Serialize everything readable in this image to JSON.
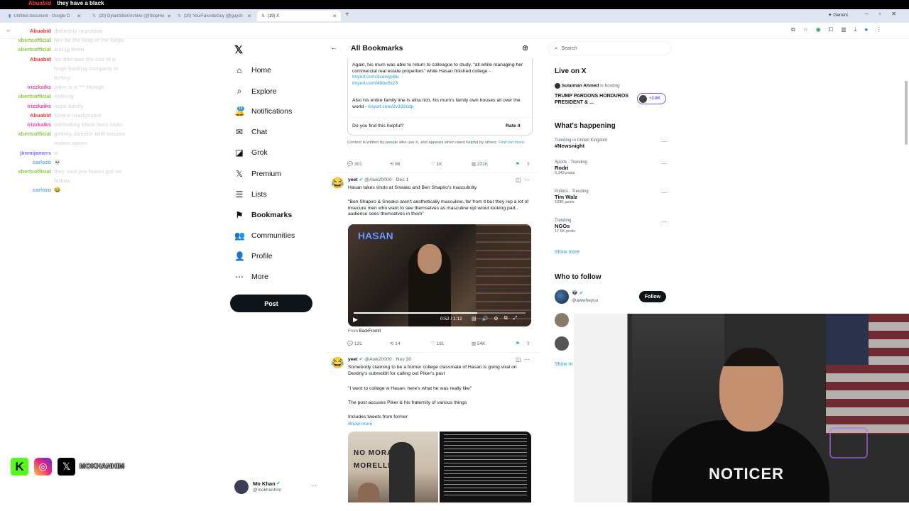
{
  "browser": {
    "tabs": [
      {
        "title": "Untitled document - Google D"
      },
      {
        "title": "(20) DylanSitterArchive (@StopHw"
      },
      {
        "title": "(20) YourFavoriteGuy (@guych"
      },
      {
        "title": "(19) X"
      }
    ],
    "gemini_label": "Gemini",
    "new_tab": "+"
  },
  "chat": {
    "top_user": "Abuabid",
    "top_message": "they have a black",
    "lines": [
      {
        "user": "Abuabid",
        "msg": "definitely nepotism",
        "color": "#ff3b3b"
      },
      {
        "user": "xbertsofficial",
        "msg": "hes be the king of the kings",
        "color": "#8acd3f"
      },
      {
        "user": "xbertsofficial",
        "msg": "and jg them",
        "color": "#8acd3f"
      },
      {
        "user": "Abuabid",
        "msg": "his dad was the ceo of a",
        "color": "#ff3b3b"
      },
      {
        "user": "",
        "msg": "huge holding company in",
        "color": "#ff3b3b"
      },
      {
        "user": "",
        "msg": "turkey",
        "color": "#ff3b3b"
      },
      {
        "user": "irizzkaiks",
        "msg": "piker is a *** though",
        "color": "#ff44aa"
      },
      {
        "user": "xbertsofficial",
        "msg": "nothing",
        "color": "#8acd3f"
      },
      {
        "user": "irizzkaiks",
        "msg": "nepo family",
        "color": "#ff44aa"
      },
      {
        "user": "Abuabid",
        "msg": "blew a headgasket",
        "color": "#ff3b3b"
      },
      {
        "user": "irizzkaiks",
        "msg": "infiltrating black lives lmao",
        "color": "#ff44aa"
      },
      {
        "user": "xbertsofficial",
        "msg": "getting sleepier with sneako",
        "color": "#8acd3f"
      },
      {
        "user": "",
        "msg": "makes sense",
        "color": "#8acd3f"
      },
      {
        "user": "jimmijamers",
        "msg": "w",
        "color": "#8a6cff"
      },
      {
        "user": "carlozo",
        "msg": "💀",
        "color": "#6aa9ff"
      },
      {
        "user": "xbertsofficial",
        "msg": "they said jew hasan got no",
        "color": "#8acd3f"
      },
      {
        "user": "",
        "msg": "hitbox",
        "color": "#8acd3f"
      },
      {
        "user": "carlozo",
        "msg": "😂",
        "color": "#6aa9ff"
      }
    ]
  },
  "branding": {
    "handle": "MOKHANHIM"
  },
  "nav": {
    "items": [
      {
        "label": "Home",
        "icon": "⌂"
      },
      {
        "label": "Explore",
        "icon": "⌕"
      },
      {
        "label": "Notifications",
        "icon": "🔔"
      },
      {
        "label": "Chat",
        "icon": "✉"
      },
      {
        "label": "Grok",
        "icon": "◪"
      },
      {
        "label": "Premium",
        "icon": "𝕏"
      },
      {
        "label": "Lists",
        "icon": "☰"
      },
      {
        "label": "Bookmarks",
        "icon": "⚑"
      },
      {
        "label": "Communities",
        "icon": "👥"
      },
      {
        "label": "Profile",
        "icon": "👤"
      },
      {
        "label": "More",
        "icon": "⋯"
      }
    ],
    "notif_badge": "18",
    "post_label": "Post",
    "account": {
      "name": "Mo Khan",
      "handle": "@mokhanhim"
    }
  },
  "header": {
    "title": "All Bookmarks"
  },
  "note": {
    "p1": "Again, his mum was able to return to colleague to study, \"all while managing her commercial real estate properties\" while Hasan finished college -",
    "link1": "tinyurl.com/3cewyp8u",
    "link2": "tinyurl.com/48be5xz3",
    "p2": "Also his entire family line is ultra rich, his mum's family own houses all over the world -",
    "link3": "tinyurl.com/2v192cdp",
    "helpful_q": "Do you find this helpful?",
    "rate": "Rate it",
    "context": "Context is written by people who use X, and appears when rated helpful by others.",
    "find_out": "Find out more."
  },
  "tweet0_actions": {
    "replies": "301",
    "reposts": "86",
    "likes": "1K",
    "views": "221K"
  },
  "tweet1": {
    "name": "yeet",
    "handle": "@Awk20000",
    "date": "· Dec 1",
    "text": "Hasan takes shots at Sneako and Ben Shapiro's masculinity",
    "quote": "\"Ben Shapiro & Sneako aren't aesthetically masculine..far from it but they rep a lot of insecure men who want to see themselves as masculine opl w/out looking part.. audience sees themselves in them\"",
    "video_time": "0:52 / 1:12",
    "from_label": "From",
    "from_source": "BackFromIt",
    "actions": {
      "replies": "131",
      "reposts": "14",
      "likes": "181",
      "views": "54K"
    }
  },
  "tweet2": {
    "name": "yeet",
    "handle": "@Awk20000",
    "date": "· Nov 30",
    "text": "Somebody claiming to be a former college classmate of Hasan is going viral on Destiny's subreddit for calling out Piker's past",
    "quote": "\"I went to college w Hasan, here's what he was really like\"",
    "p2": "The post accuses Piker & his fraternity of various things",
    "p3": "Includes tweets from former",
    "show_more": "Show more"
  },
  "right": {
    "search_placeholder": "Search",
    "live_title": "Live on X",
    "live_host": "Sulaiman Ahmed",
    "live_hosting": "is hosting",
    "live_text": "TRUMP PARDONS HONDUROS PRESIDENT & ...",
    "live_count": "+2.8K",
    "happening_title": "What's happening",
    "trends": [
      {
        "meta": "Trending in United Kingdom",
        "name": "#Newsnight",
        "count": ""
      },
      {
        "meta": "Sports · Trending",
        "name": "Rodri",
        "count": "6,343 posts"
      },
      {
        "meta": "Politics · Trending",
        "name": "Tim Walz",
        "count": "183K posts"
      },
      {
        "meta": "Trending",
        "name": "NGOs",
        "count": "17.5K posts"
      }
    ],
    "show_more": "Show more",
    "wtf_title": "Who to follow",
    "follow_label": "Follow",
    "follow_handle": "@awwheyuu",
    "webcam_shirt": "NOTICER"
  },
  "colors": {
    "accent": "#1d9bf0",
    "dark": "#0f1419",
    "chat_green": "#8acd3f",
    "chat_red": "#ff3b3b"
  }
}
